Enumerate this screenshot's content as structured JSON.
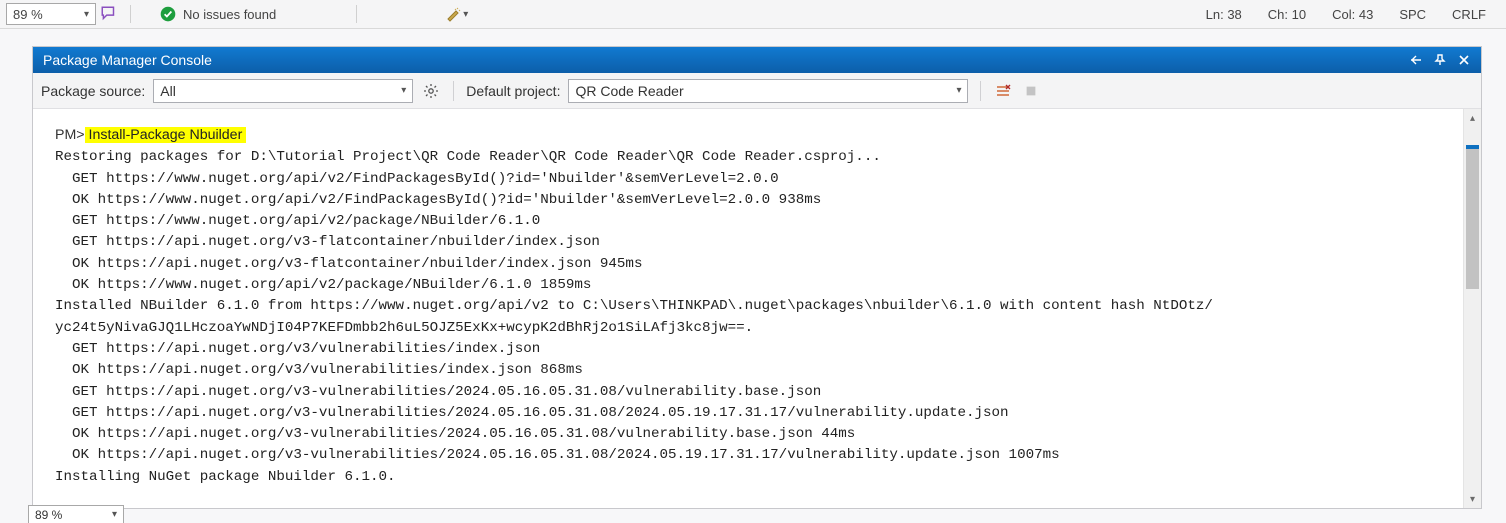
{
  "status_bar": {
    "zoom_value": "89 %",
    "no_issues": "No issues found",
    "ln": "Ln: 38",
    "ch": "Ch: 10",
    "col": "Col: 43",
    "spc": "SPC",
    "crlf": "CRLF"
  },
  "panel": {
    "title": "Package Manager Console"
  },
  "toolbar": {
    "package_source_label": "Package source:",
    "package_source_value": "All",
    "default_project_label": "Default project:",
    "default_project_value": "QR Code Reader"
  },
  "console": {
    "prompt": "PM>",
    "highlighted_command": " Install-Package Nbuilder ",
    "lines": [
      "Restoring packages for D:\\Tutorial Project\\QR Code Reader\\QR Code Reader\\QR Code Reader.csproj...",
      "  GET https://www.nuget.org/api/v2/FindPackagesById()?id='Nbuilder'&semVerLevel=2.0.0",
      "  OK https://www.nuget.org/api/v2/FindPackagesById()?id='Nbuilder'&semVerLevel=2.0.0 938ms",
      "  GET https://www.nuget.org/api/v2/package/NBuilder/6.1.0",
      "  GET https://api.nuget.org/v3-flatcontainer/nbuilder/index.json",
      "  OK https://api.nuget.org/v3-flatcontainer/nbuilder/index.json 945ms",
      "  OK https://www.nuget.org/api/v2/package/NBuilder/6.1.0 1859ms",
      "Installed NBuilder 6.1.0 from https://www.nuget.org/api/v2 to C:\\Users\\THINKPAD\\.nuget\\packages\\nbuilder\\6.1.0 with content hash NtDOtz/",
      "yc24t5yNivaGJQ1LHczoaYwNDjI04P7KEFDmbb2h6uL5OJZ5ExKx+wcypK2dBhRj2o1SiLAfj3kc8jw==.",
      "  GET https://api.nuget.org/v3/vulnerabilities/index.json",
      "  OK https://api.nuget.org/v3/vulnerabilities/index.json 868ms",
      "  GET https://api.nuget.org/v3-vulnerabilities/2024.05.16.05.31.08/vulnerability.base.json",
      "  GET https://api.nuget.org/v3-vulnerabilities/2024.05.16.05.31.08/2024.05.19.17.31.17/vulnerability.update.json",
      "  OK https://api.nuget.org/v3-vulnerabilities/2024.05.16.05.31.08/vulnerability.base.json 44ms",
      "  OK https://api.nuget.org/v3-vulnerabilities/2024.05.16.05.31.08/2024.05.19.17.31.17/vulnerability.update.json 1007ms",
      "Installing NuGet package Nbuilder 6.1.0."
    ]
  },
  "bottom_zoom": {
    "value": "89 %"
  }
}
